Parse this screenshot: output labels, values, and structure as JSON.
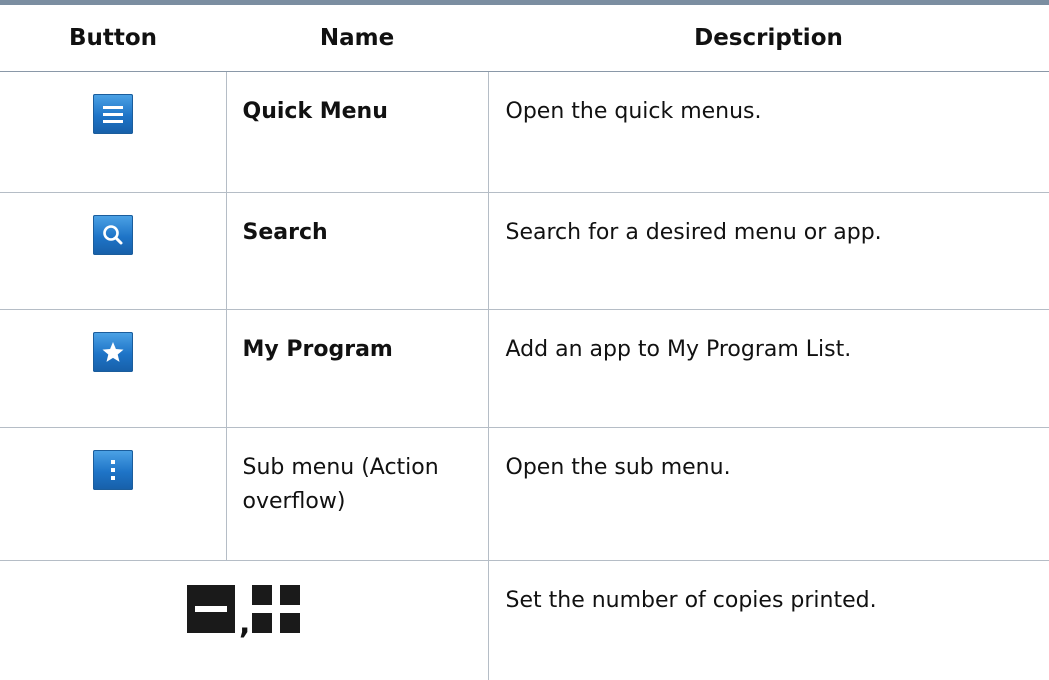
{
  "table": {
    "headers": {
      "button": "Button",
      "name": "Name",
      "description": "Description"
    },
    "rows": [
      {
        "icon": "quick-menu-icon",
        "name": "Quick Menu",
        "description": "Open the quick menus."
      },
      {
        "icon": "search-icon",
        "name": "Search",
        "description": "Search for a desired menu or app."
      },
      {
        "icon": "star-icon",
        "name": "My Program",
        "description": "Add an app to My Program List."
      },
      {
        "icon": "action-overflow-icon",
        "name_line1": "Sub menu (Action",
        "name_line2": "overflow)",
        "description": "Open the sub menu."
      },
      {
        "icons": [
          "minus-icon",
          "plus-icon"
        ],
        "separator": ",",
        "description": "Set the number of copies printed."
      }
    ]
  },
  "colors": {
    "top_rule": "#7b8ea1",
    "icon_blue": "#1e74c7",
    "stepper_dark": "#1a1a1a",
    "grid_line": "#b5bdc6"
  }
}
